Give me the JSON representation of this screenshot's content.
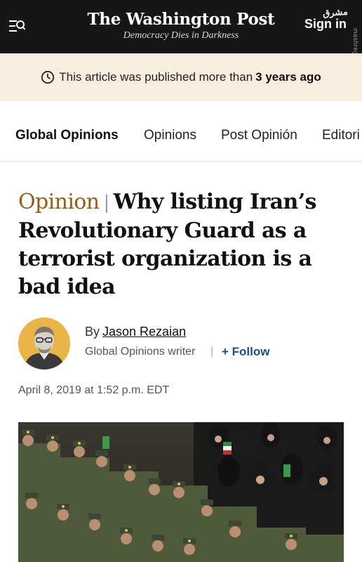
{
  "header": {
    "menu_icon": "menu-search-icon",
    "logo": "The Washington Post",
    "tagline": "Democracy Dies in Darkness",
    "signin": "Sign in",
    "watermark_fa": "مشرق",
    "watermark_url": "mashreghnews.ir"
  },
  "notice": {
    "icon": "clock-icon",
    "text": "This article was published more than",
    "emphasis": "3 years ago"
  },
  "nav": {
    "items": [
      "Global Opinions",
      "Opinions",
      "Post Opinión",
      "Editori"
    ]
  },
  "article": {
    "kicker": "Opinion",
    "separator": "|",
    "title": "Why listing Iran’s Revolutionary Guard as a terrorist organization is a bad idea",
    "byline_prefix": "By",
    "author": "Jason Rezaian",
    "role": "Global Opinions writer",
    "pipe": "|",
    "follow": "+ Follow",
    "date": "April 8, 2019 at 1:52 p.m. EDT"
  },
  "colors": {
    "header_bg": "#161616",
    "notice_bg": "#f8eede",
    "kicker": "#9a5a12",
    "follow": "#1a4f86"
  }
}
